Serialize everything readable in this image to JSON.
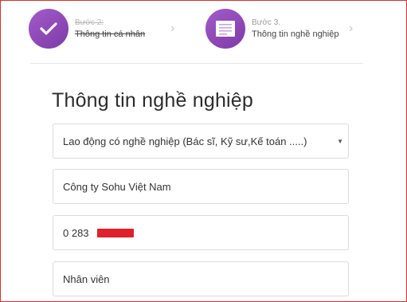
{
  "stepper": {
    "step2": {
      "label": "Bước 2:",
      "title": "Thông tin cá nhân",
      "status": "completed",
      "icon": "checkmark-icon"
    },
    "step3": {
      "label": "Bước 3.",
      "title": "Thông tin nghề nghiệp",
      "status": "current",
      "icon": "document-icon"
    },
    "accent_color": "#8b45b5"
  },
  "form": {
    "title": "Thông tin nghề nghiệp",
    "occupation_select": "Lao động có nghề nghiệp (Bác sĩ, Kỹ sư,Kế toán .....)",
    "company_field": "Công ty Sohu Việt Nam",
    "phone_field": "0 283",
    "position_field": "Nhân viên"
  }
}
